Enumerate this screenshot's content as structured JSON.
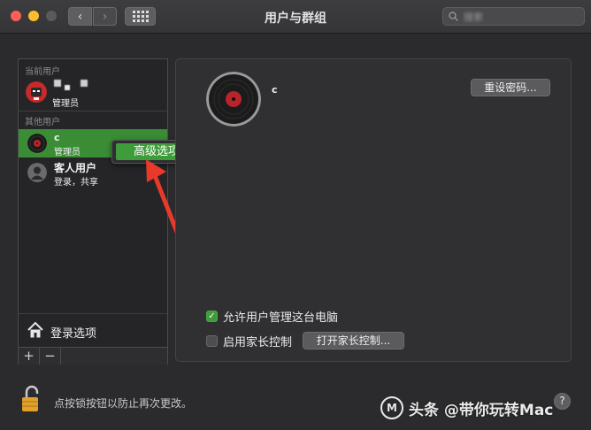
{
  "window": {
    "title": "用户与群组"
  },
  "toolbar": {
    "search_placeholder": "搜索",
    "back_icon": "chevron-left-icon",
    "forward_icon": "chevron-right-icon",
    "grid_icon": "grid-icon"
  },
  "sidebar": {
    "current_users_label": "当前用户",
    "current_user": {
      "role": "管理员"
    },
    "other_users_label": "其他用户",
    "users": [
      {
        "name": "c",
        "role": "管理员",
        "selected": true
      },
      {
        "name": "客人用户",
        "role": "登录，共享",
        "selected": false
      }
    ],
    "login_options_label": "登录选项",
    "add_label": "+",
    "remove_label": "−"
  },
  "context_menu": {
    "item": "高级选项..."
  },
  "panel": {
    "username": "c",
    "reset_password_button": "重设密码...",
    "allow_admin_label": "允许用户管理这台电脑",
    "allow_admin_checked": true,
    "parental_controls_label": "启用家长控制",
    "parental_controls_checked": false,
    "open_parental_button": "打开家长控制..."
  },
  "footer": {
    "lock_text": "点按锁按钮以防止再次更改。",
    "help_label": "?",
    "watermark": "头条 @带你玩转Mac",
    "watermark_logo": "M"
  },
  "colors": {
    "accent_green": "#3f9c3a",
    "annotation_red": "#e8392b"
  }
}
